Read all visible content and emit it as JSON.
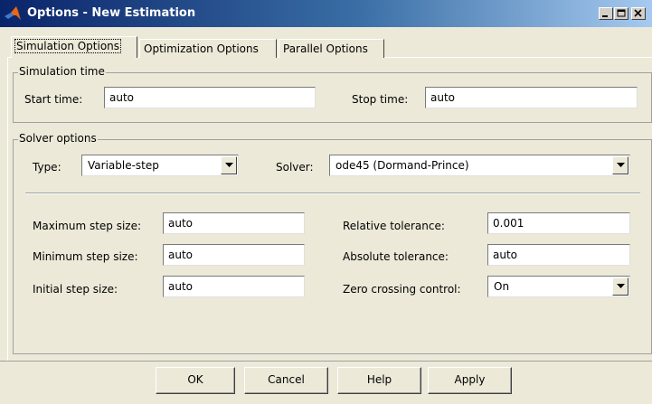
{
  "window": {
    "title": "Options - New Estimation",
    "icon": "matlab-logo-icon",
    "controls": {
      "minimize": "minimize-icon",
      "maximize": "maximize-icon",
      "close": "close-icon"
    }
  },
  "tabs": [
    {
      "label": "Simulation Options",
      "active": true
    },
    {
      "label": "Optimization Options",
      "active": false
    },
    {
      "label": "Parallel Options",
      "active": false
    }
  ],
  "simulation_time": {
    "legend": "Simulation time",
    "start_label": "Start time:",
    "start_value": "auto",
    "stop_label": "Stop time:",
    "stop_value": "auto"
  },
  "solver_options": {
    "legend": "Solver options",
    "type_label": "Type:",
    "type_value": "Variable-step",
    "solver_label": "Solver:",
    "solver_value": "ode45 (Dormand-Prince)",
    "max_step_label": "Maximum step size:",
    "max_step_value": "auto",
    "min_step_label": "Minimum step size:",
    "min_step_value": "auto",
    "init_step_label": "Initial step size:",
    "init_step_value": "auto",
    "rel_tol_label": "Relative tolerance:",
    "rel_tol_value": "0.001",
    "abs_tol_label": "Absolute tolerance:",
    "abs_tol_value": "auto",
    "zero_cross_label": "Zero crossing control:",
    "zero_cross_value": "On"
  },
  "buttons": {
    "ok": "OK",
    "cancel": "Cancel",
    "help": "Help",
    "apply": "Apply"
  },
  "colors": {
    "titlebar_start": "#0a246a",
    "titlebar_end": "#a6caf0",
    "face": "#ece9d8"
  }
}
